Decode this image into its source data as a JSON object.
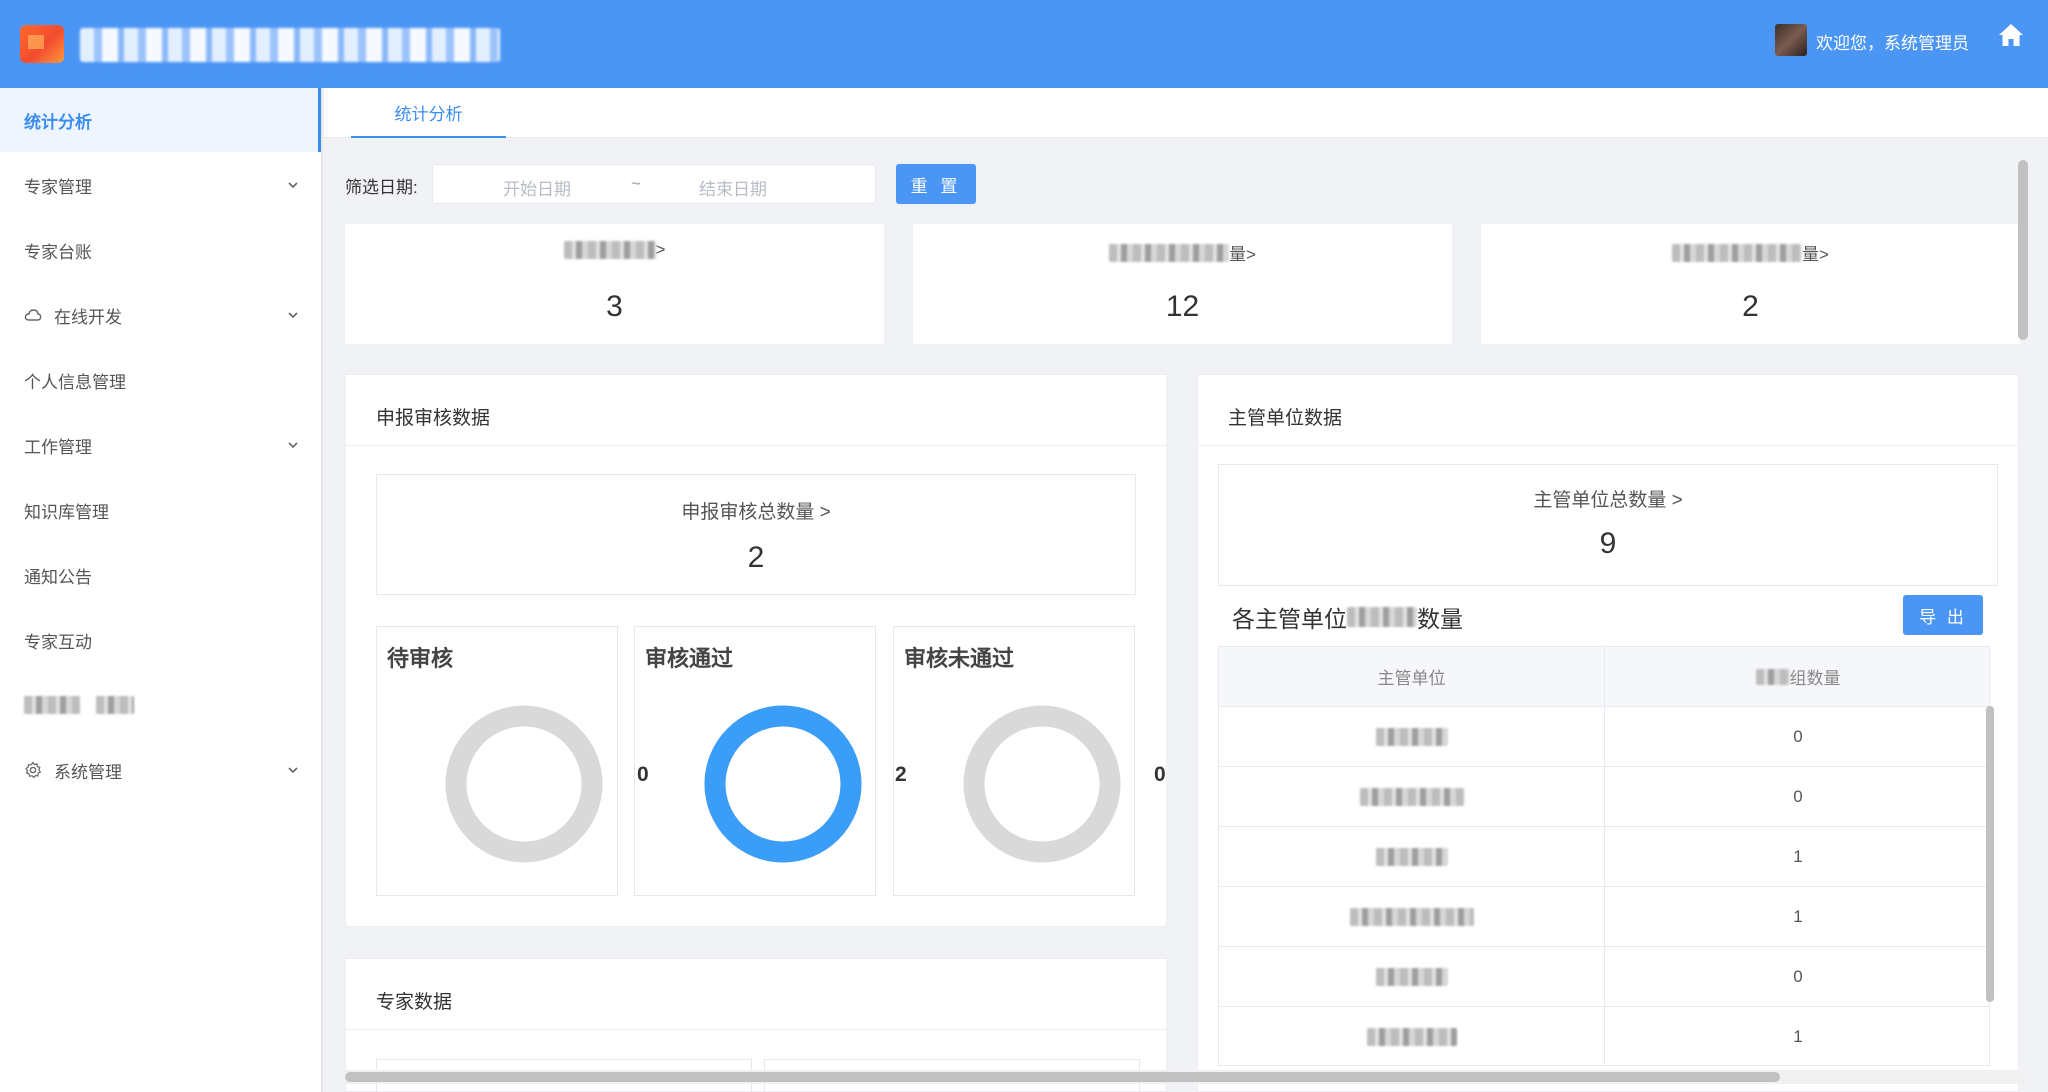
{
  "header": {
    "welcome": "欢迎您，系统管理员",
    "accent_color": "#4b96f5",
    "home_icon": "home-icon"
  },
  "sidebar": {
    "items": [
      {
        "label": "统计分析",
        "active": true,
        "has_chevron": false,
        "icon": ""
      },
      {
        "label": "专家管理",
        "active": false,
        "has_chevron": true,
        "icon": ""
      },
      {
        "label": "专家台账",
        "active": false,
        "has_chevron": false,
        "icon": ""
      },
      {
        "label": "在线开发",
        "active": false,
        "has_chevron": true,
        "icon": "cloud-icon"
      },
      {
        "label": "个人信息管理",
        "active": false,
        "has_chevron": false,
        "icon": ""
      },
      {
        "label": "工作管理",
        "active": false,
        "has_chevron": true,
        "icon": ""
      },
      {
        "label": "知识库管理",
        "active": false,
        "has_chevron": false,
        "icon": ""
      },
      {
        "label": "通知公告",
        "active": false,
        "has_chevron": false,
        "icon": ""
      },
      {
        "label": "专家互动",
        "active": false,
        "has_chevron": false,
        "icon": ""
      },
      {
        "label": "",
        "active": false,
        "has_chevron": false,
        "icon": ""
      },
      {
        "label": "系统管理",
        "active": false,
        "has_chevron": true,
        "icon": "gear-icon"
      }
    ]
  },
  "tabs": [
    {
      "label": "统计分析",
      "active": true
    }
  ],
  "filter": {
    "label": "筛选日期:",
    "start_placeholder": "开始日期",
    "separator": "~",
    "end_placeholder": "结束日期",
    "reset_label": "重 置"
  },
  "stats": [
    {
      "label_suffix": ">",
      "value": "3"
    },
    {
      "label_suffix": "量>",
      "value": "12"
    },
    {
      "label_suffix": "量>",
      "value": "2"
    }
  ],
  "review_panel": {
    "title": "申报审核数据",
    "total_label": "申报审核总数量 >",
    "total_value": "2",
    "statuses": [
      {
        "title": "待审核",
        "count": "0",
        "ratio": 0
      },
      {
        "title": "审核通过",
        "count": "2",
        "ratio": 1
      },
      {
        "title": "审核未通过",
        "count": "0",
        "ratio": 0
      }
    ],
    "ring_active_color": "#3a9df8",
    "ring_empty_color": "#d9d9d9"
  },
  "expert_panel": {
    "title": "专家数据"
  },
  "unit_panel": {
    "title": "主管单位数据",
    "total_label": "主管单位总数量 >",
    "total_value": "9",
    "sub_title_prefix": "各主管单位",
    "sub_title_suffix": "数量",
    "export_label": "导 出",
    "table": {
      "headers": [
        "主管单位",
        "组数量"
      ],
      "rows": [
        {
          "count": "0"
        },
        {
          "count": "0"
        },
        {
          "count": "1"
        },
        {
          "count": "1"
        },
        {
          "count": "0"
        },
        {
          "count": "1"
        }
      ]
    }
  }
}
